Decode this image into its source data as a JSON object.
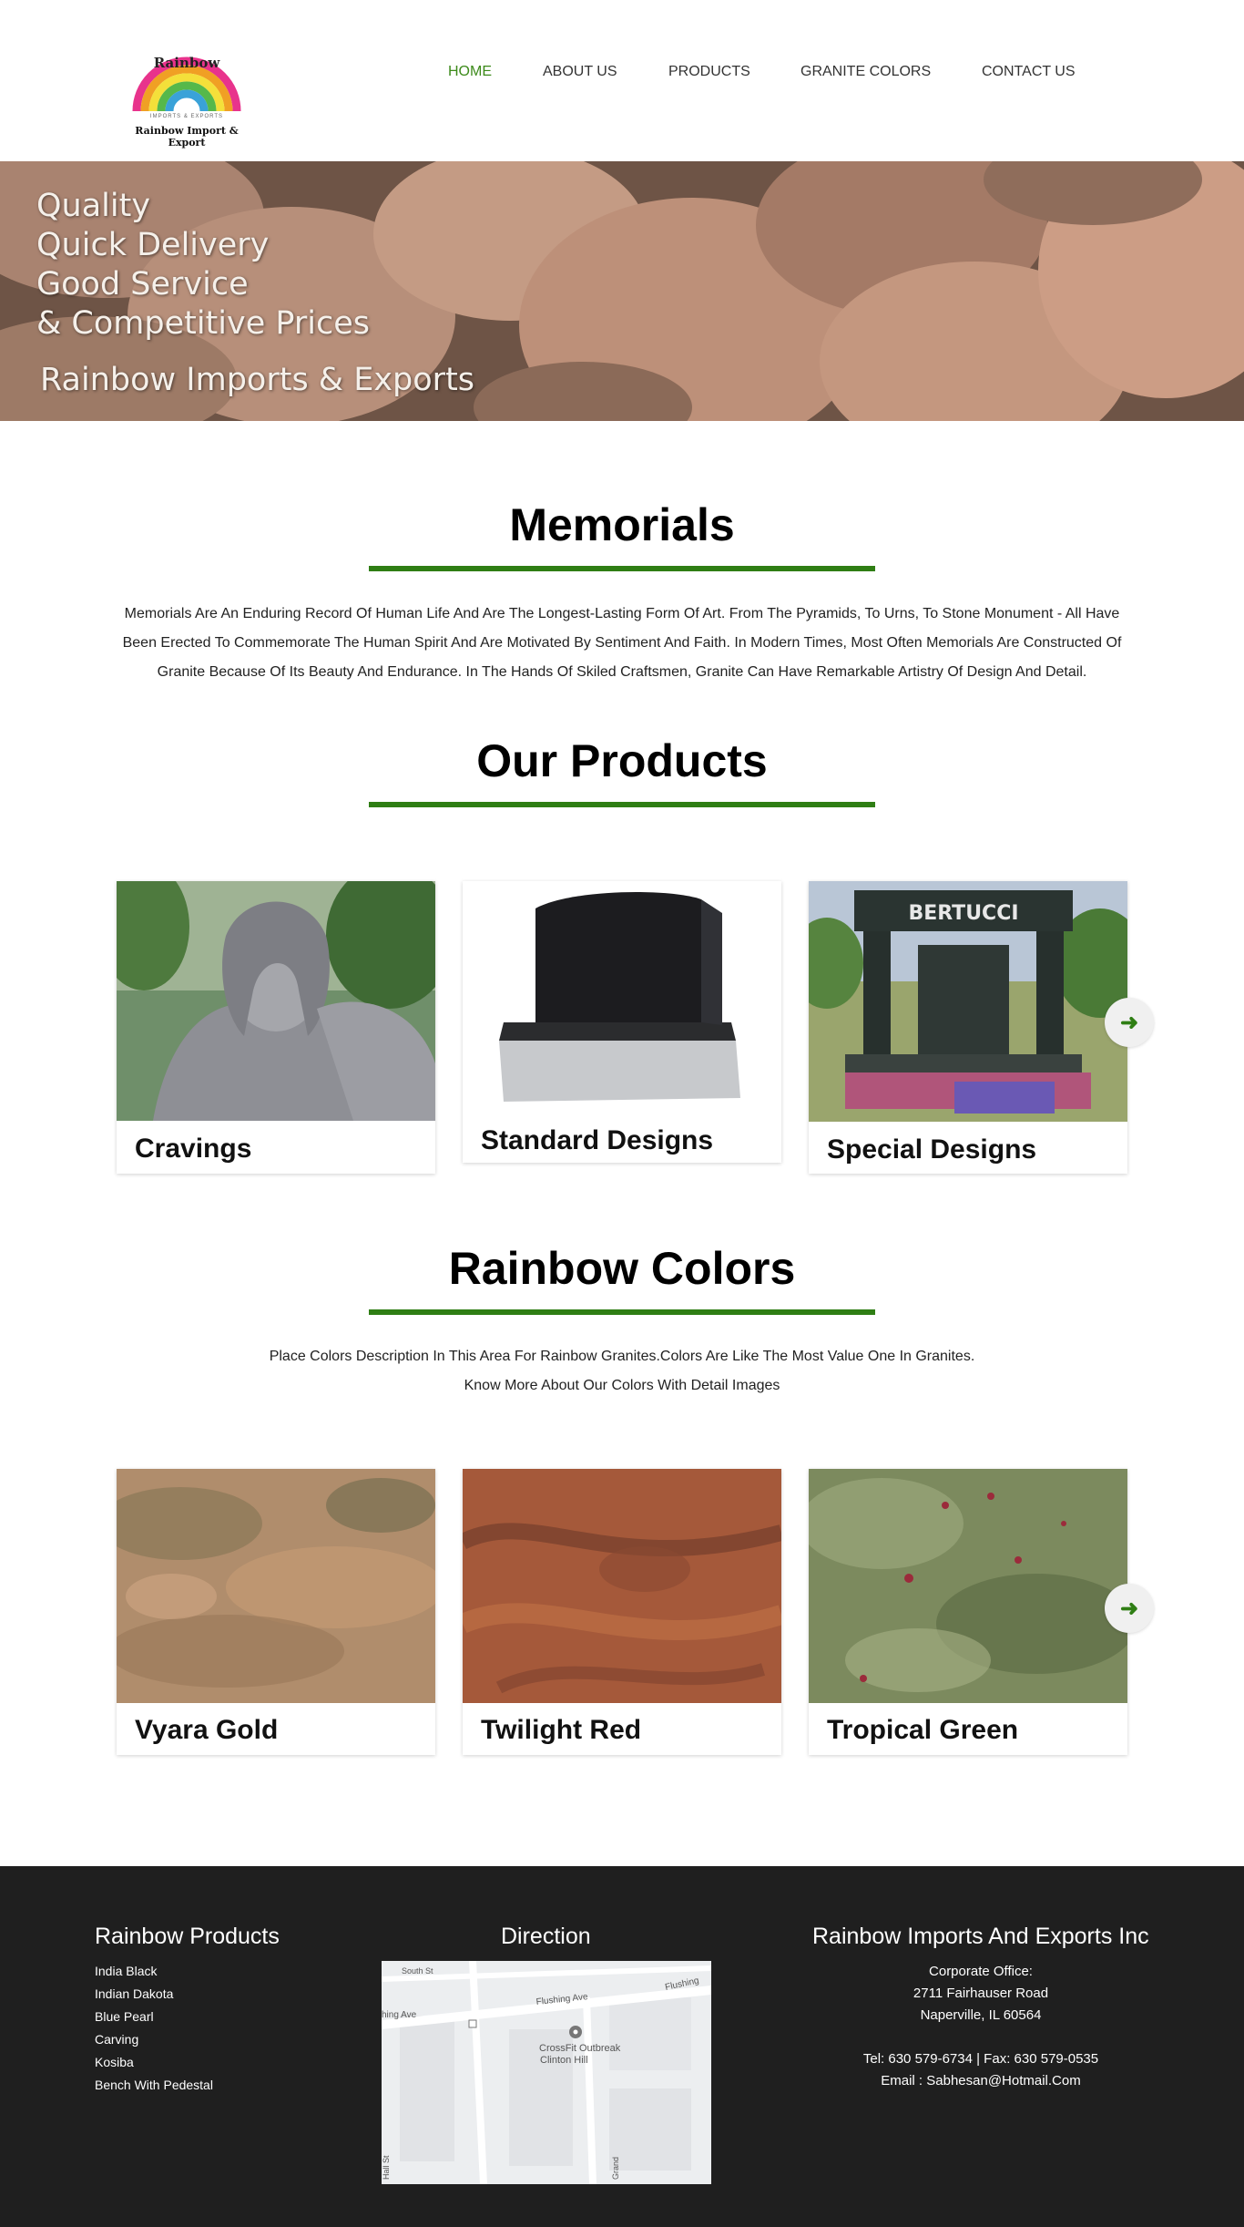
{
  "header": {
    "logo_word": "Rainbow",
    "logo_small": "IMPORTS & EXPORTS",
    "logo_tagline": "Rainbow Import & Export",
    "nav": [
      {
        "label": "HOME",
        "active": true
      },
      {
        "label": "ABOUT US",
        "active": false
      },
      {
        "label": "PRODUCTS",
        "active": false
      },
      {
        "label": "GRANITE COLORS",
        "active": false
      },
      {
        "label": "CONTACT US",
        "active": false
      }
    ],
    "accent": "#3c8a1a"
  },
  "banner": {
    "lines": [
      "Quality",
      "Quick Delivery",
      "Good Service",
      "& Competitive Prices"
    ],
    "subtitle": "Rainbow Imports & Exports"
  },
  "memorials": {
    "title": "Memorials",
    "text": "Memorials Are An Enduring Record Of Human Life And Are The Longest-Lasting Form Of Art. From The Pyramids, To Urns, To Stone Monument - All Have Been Erected To Commemorate The Human Spirit And Are Motivated By Sentiment And Faith. In Modern Times, Most Often Memorials Are Constructed Of Granite Because Of Its Beauty And Endurance. In The Hands Of Skiled Craftsmen, Granite Can Have Remarkable Artistry Of Design And Detail."
  },
  "products": {
    "title": "Our Products",
    "items": [
      {
        "label": "Cravings"
      },
      {
        "label": "Standard Designs"
      },
      {
        "label": "Special Designs",
        "sign": "BERTUCCI"
      }
    ],
    "next_icon": "arrow-right-icon"
  },
  "colors": {
    "title": "Rainbow Colors",
    "line1": "Place Colors Description In This Area For Rainbow Granites.Colors Are Like The Most Value One In Granites.",
    "line2": "Know More About Our Colors With Detail Images",
    "items": [
      {
        "label": "Vyara Gold",
        "swatch": "#b08d6c"
      },
      {
        "label": "Twilight Red",
        "swatch": "#a5593a"
      },
      {
        "label": "Tropical Green",
        "swatch": "#7c8a5e"
      }
    ],
    "next_icon": "arrow-right-icon"
  },
  "footer": {
    "products_title": "Rainbow Products",
    "products": [
      "India Black",
      "Indian Dakota",
      "Blue Pearl",
      "Carving",
      "Kosiba",
      "Bench With Pedestal"
    ],
    "direction_title": "Direction",
    "map": {
      "streets": [
        "South St",
        "Flushing Ave",
        "Flushing",
        "hing Ave",
        "Hall St",
        "Grand"
      ],
      "place_line1": "CrossFit Outbreak",
      "place_line2": "Clinton Hill"
    },
    "company_title": "Rainbow Imports And Exports Inc",
    "office_label": "Corporate Office:",
    "address1": "2711 Fairhauser Road",
    "address2": "Naperville, IL 60564",
    "phone": "Tel: 630 579-6734 | Fax: 630 579-0535",
    "email": "Email : Sabhesan@Hotmail.Com"
  }
}
